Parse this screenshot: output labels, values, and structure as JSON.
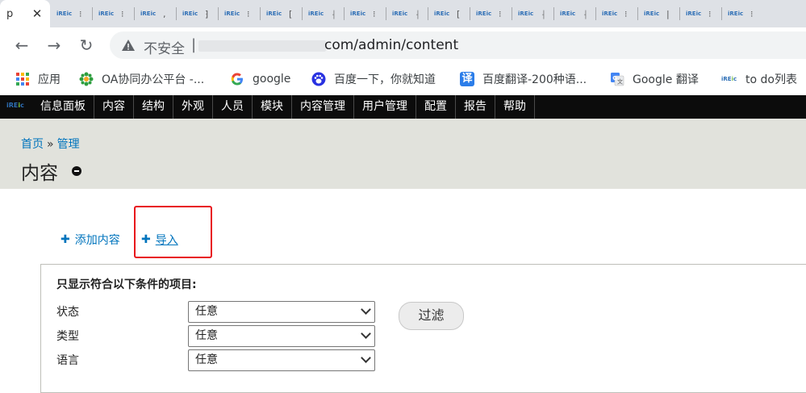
{
  "browser": {
    "active_tab": {
      "title": "p",
      "close": "✕"
    },
    "tabs": [
      {
        "favicon": "iREic",
        "glyph": "⁝"
      },
      {
        "favicon": "iREic",
        "glyph": "⁝"
      },
      {
        "favicon": "iREic",
        "glyph": ","
      },
      {
        "favicon": "iREic",
        "glyph": "⁆"
      },
      {
        "favicon": "iREic",
        "glyph": "⁝"
      },
      {
        "favicon": "iREic",
        "glyph": "["
      },
      {
        "favicon": "iREic",
        "glyph": "⸡"
      },
      {
        "favicon": "iREic",
        "glyph": "⁝"
      },
      {
        "favicon": "iREic",
        "glyph": "⸡"
      },
      {
        "favicon": "iREic",
        "glyph": "["
      },
      {
        "favicon": "iREic",
        "glyph": "⁝"
      },
      {
        "favicon": "iREic",
        "glyph": "⸡"
      },
      {
        "favicon": "iREic",
        "glyph": "⸡"
      },
      {
        "favicon": "iREic",
        "glyph": "⁝"
      },
      {
        "favicon": "iREic",
        "glyph": "|"
      },
      {
        "favicon": "iREic",
        "glyph": "⁝"
      },
      {
        "favicon": "iREic",
        "glyph": "⁝"
      }
    ],
    "nav": {
      "back": "←",
      "forward": "→",
      "reload": "↻"
    },
    "omnibox": {
      "security_label": "不安全",
      "separator": "|",
      "url": "com/admin/content"
    },
    "bookmarks": [
      {
        "label": "应用",
        "icon": "apps-grid-icon"
      },
      {
        "label": "OA协同办公平台 -...",
        "icon": "oa-flower-icon"
      },
      {
        "label": "google",
        "icon": "google-g-icon"
      },
      {
        "label": "百度一下，你就知道",
        "icon": "baidu-paw-icon"
      },
      {
        "label": "百度翻译-200种语...",
        "icon": "baidu-translate-icon"
      },
      {
        "label": "Google 翻译",
        "icon": "google-translate-icon"
      },
      {
        "label": "to do列表",
        "icon": "ireic-favicon-icon"
      }
    ]
  },
  "admin_toolbar": {
    "logo": "iREic",
    "items": [
      "信息面板",
      "内容",
      "结构",
      "外观",
      "人员",
      "模块",
      "内容管理",
      "用户管理",
      "配置",
      "报告",
      "帮助"
    ]
  },
  "header": {
    "breadcrumb": {
      "home": "首页",
      "separator": "»",
      "current": "管理"
    },
    "title": "内容"
  },
  "actions": {
    "add_content": "添加内容",
    "import": "导入",
    "plus": "✚"
  },
  "filter": {
    "legend": "只显示符合以下条件的项目:",
    "rows": [
      {
        "label": "状态",
        "value": "任意"
      },
      {
        "label": "类型",
        "value": "任意"
      },
      {
        "label": "语言",
        "value": "任意"
      }
    ],
    "button": "过滤"
  },
  "colors": {
    "link": "#0074bd",
    "highlight_box": "#e8141b",
    "admin_bar": "#0c0c0c",
    "header_bg": "#e1e2dc"
  }
}
